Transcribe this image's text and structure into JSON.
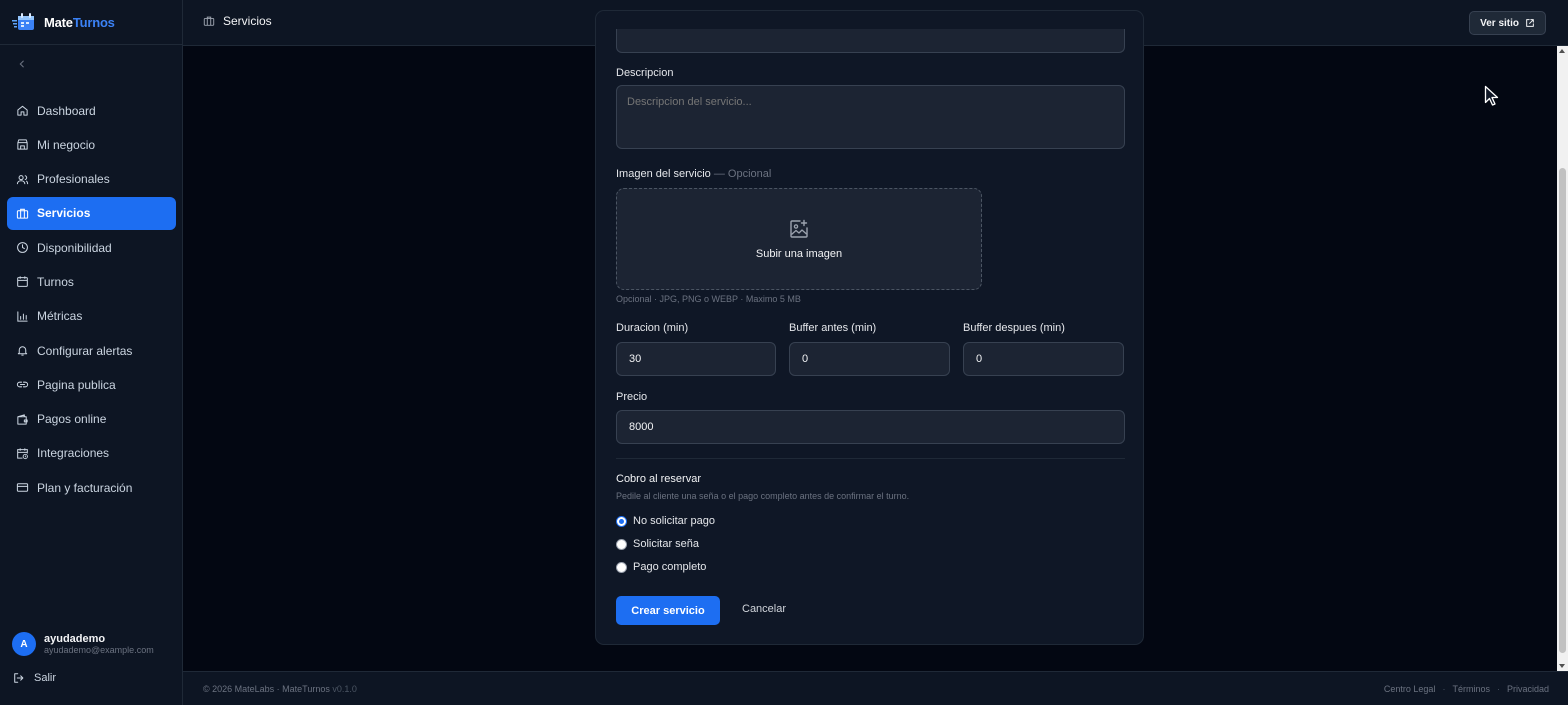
{
  "brand": {
    "part1": "Mate",
    "part2": "Turnos"
  },
  "colors": {
    "accent": "#1d6ef2",
    "background": "#030712",
    "panel": "#0d1523"
  },
  "sidebar": {
    "collapse_icon": "chevron-left-icon",
    "items": [
      {
        "label": "Dashboard",
        "icon": "home-icon",
        "active": false
      },
      {
        "label": "Mi negocio",
        "icon": "store-icon",
        "active": false
      },
      {
        "label": "Profesionales",
        "icon": "users-icon",
        "active": false
      },
      {
        "label": "Servicios",
        "icon": "briefcase-icon",
        "active": true
      },
      {
        "label": "Disponibilidad",
        "icon": "clock-icon",
        "active": false
      },
      {
        "label": "Turnos",
        "icon": "calendar-icon",
        "active": false
      },
      {
        "label": "Métricas",
        "icon": "bar-chart-icon",
        "active": false
      },
      {
        "label": "Configurar alertas",
        "icon": "bell-icon",
        "active": false
      },
      {
        "label": "Pagina publica",
        "icon": "link-icon",
        "active": false
      },
      {
        "label": "Pagos online",
        "icon": "wallet-icon",
        "active": false
      },
      {
        "label": "Integraciones",
        "icon": "calendar-clock-icon",
        "active": false
      },
      {
        "label": "Plan y facturación",
        "icon": "credit-card-icon",
        "active": false
      }
    ],
    "user": {
      "initial": "A",
      "name": "ayudademo",
      "email": "ayudademo@example.com"
    },
    "logout_label": "Salir"
  },
  "header": {
    "breadcrumb": "Servicios",
    "view_site_label": "Ver sitio"
  },
  "form": {
    "description_label": "Descripcion",
    "description_placeholder": "Descripcion del servicio...",
    "image_label": "Imagen del servicio",
    "image_optional": "— Opcional",
    "upload_label": "Subir una imagen",
    "upload_hint": "Opcional · JPG, PNG o WEBP · Maximo 5 MB",
    "duration_label": "Duracion (min)",
    "duration_value": "30",
    "buffer_before_label": "Buffer antes (min)",
    "buffer_before_value": "0",
    "buffer_after_label": "Buffer despues (min)",
    "buffer_after_value": "0",
    "price_label": "Precio",
    "price_value": "8000",
    "payment_title": "Cobro al reservar",
    "payment_desc": "Pedile al cliente una seña o el pago completo antes de confirmar el turno.",
    "payment_options": [
      {
        "label": "No solicitar pago",
        "checked": true
      },
      {
        "label": "Solicitar seña",
        "checked": false
      },
      {
        "label": "Pago completo",
        "checked": false
      }
    ],
    "submit_label": "Crear servicio",
    "cancel_label": "Cancelar"
  },
  "footer": {
    "copyright": "© 2026 MateLabs · MateTurnos",
    "version": "v0.1.0",
    "links": [
      "Centro Legal",
      "Términos",
      "Privacidad"
    ],
    "separator": "·"
  }
}
